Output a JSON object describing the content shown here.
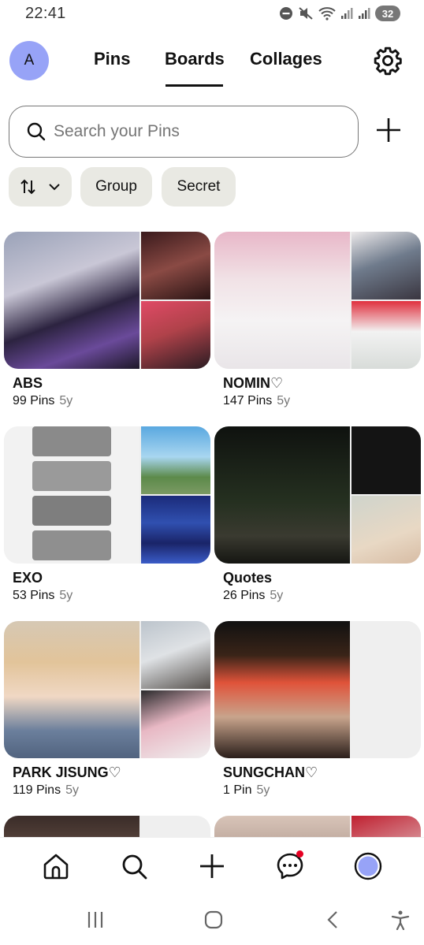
{
  "status_bar": {
    "time": "22:41",
    "battery": "32"
  },
  "profile": {
    "initial": "A"
  },
  "tabs": [
    {
      "label": "Pins",
      "active": false
    },
    {
      "label": "Boards",
      "active": true
    },
    {
      "label": "Collages",
      "active": false
    }
  ],
  "search": {
    "placeholder": "Search your Pins"
  },
  "filters": [
    {
      "label": "",
      "icon": "sort-icon"
    },
    {
      "label": "Group"
    },
    {
      "label": "Secret"
    }
  ],
  "boards": [
    {
      "title": "ABS",
      "pins": "99 Pins",
      "age": "5y"
    },
    {
      "title": "NOMIN♡",
      "pins": "147 Pins",
      "age": "5y"
    },
    {
      "title": "EXO",
      "pins": "53 Pins",
      "age": "5y"
    },
    {
      "title": "Quotes",
      "pins": "26 Pins",
      "age": "5y"
    },
    {
      "title": "PARK JISUNG♡",
      "pins": "119 Pins",
      "age": "5y"
    },
    {
      "title": "SUNGCHAN♡",
      "pins": "1 Pin",
      "age": "5y"
    }
  ],
  "colors": {
    "accent": "#e60023",
    "avatar_bg": "#97a3f7",
    "chip_bg": "#e9e9e3"
  },
  "bottom_nav": [
    "home-icon",
    "search-icon",
    "create-icon",
    "messages-icon",
    "profile-icon"
  ]
}
